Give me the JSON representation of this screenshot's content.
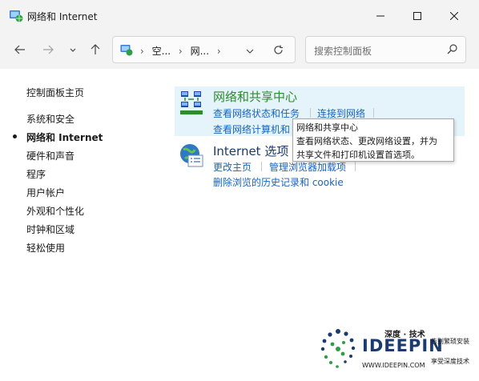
{
  "window": {
    "title": "网络和 Internet",
    "icons": {
      "app": "network-globe-icon",
      "minimize": "minimize-icon",
      "maximize": "maximize-icon",
      "close": "close-icon"
    }
  },
  "nav": {
    "back_icon": "arrow-left-icon",
    "forward_icon": "arrow-right-icon",
    "recent_icon": "chevron-down-icon",
    "up_icon": "arrow-up-icon",
    "breadcrumbs": [
      "空...",
      "网...",
      ""
    ],
    "refresh_icon": "refresh-icon",
    "search": {
      "placeholder": "搜索控制面板",
      "icon": "search-icon"
    }
  },
  "sidebar": {
    "items": [
      {
        "label": "控制面板主页"
      },
      {
        "label": "系统和安全"
      },
      {
        "label": "网络和 Internet",
        "current": true
      },
      {
        "label": "硬件和声音"
      },
      {
        "label": "程序"
      },
      {
        "label": "用户帐户"
      },
      {
        "label": "外观和个性化"
      },
      {
        "label": "时钟和区域"
      },
      {
        "label": "轻松使用"
      }
    ]
  },
  "sections": [
    {
      "title": "网络和共享中心",
      "icon": "network-sharing-center-icon",
      "links": [
        "查看网络状态和任务",
        "连接到网络",
        "查看网络计算机和"
      ]
    },
    {
      "title": "Internet 选项",
      "icon": "internet-options-icon",
      "links": [
        "更改主页",
        "管理浏览器加载项",
        "删除浏览的历史记录和 cookie"
      ]
    }
  ],
  "tooltip": {
    "lines": [
      "网络和共享中心",
      "查看网络状态、更改网络设置，并为",
      "共享文件和打印机设置首选项。"
    ]
  },
  "watermark": {
    "brand_cn": "深度 · 技术",
    "brand": "IDEEPIN",
    "url": "WWW.IDEEPIN.COM",
    "slogan1": "告别繁琐安装",
    "slogan2": "享受深度技术"
  },
  "colors": {
    "accent_green": "#2e8b2e",
    "link_blue": "#1565c0",
    "hover_bg": "#e5f3fb"
  }
}
